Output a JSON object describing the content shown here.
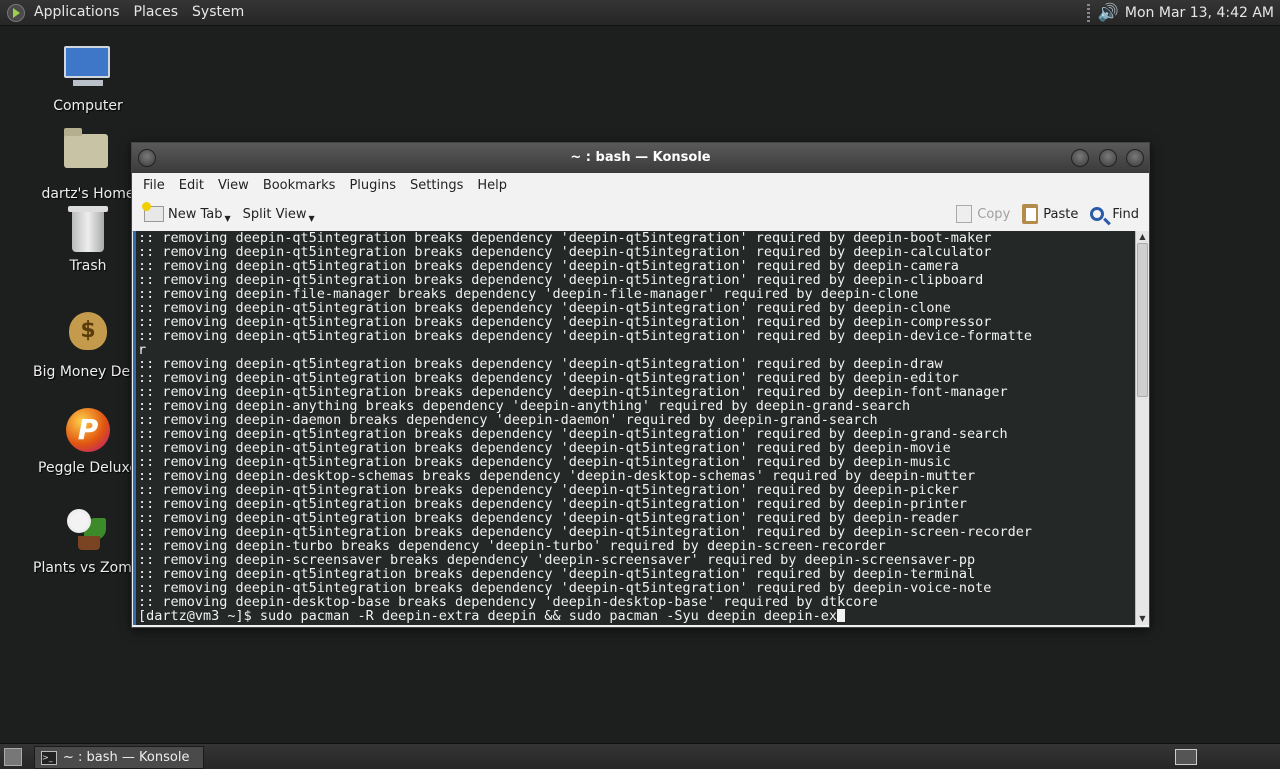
{
  "top_panel": {
    "menus": [
      "Applications",
      "Places",
      "System"
    ],
    "clock": "Mon Mar 13,  4:42 AM",
    "volume_icon": "speaker-icon"
  },
  "desktop_icons": [
    {
      "label": "Computer",
      "icon": "computer-icon"
    },
    {
      "label": "dartz's Home",
      "icon": "home-folder-icon"
    },
    {
      "label": "Trash",
      "icon": "trash-icon"
    },
    {
      "label": "Big Money Delux",
      "icon": "money-bag-icon"
    },
    {
      "label": "Peggle Deluxe",
      "icon": "peggle-icon"
    },
    {
      "label": "Plants vs Zombi",
      "icon": "plants-vs-zombies-icon"
    }
  ],
  "window": {
    "title": "~ : bash — Konsole",
    "menu": [
      "File",
      "Edit",
      "View",
      "Bookmarks",
      "Plugins",
      "Settings",
      "Help"
    ],
    "toolbar": {
      "new_tab": "New Tab",
      "split_view": "Split View",
      "copy": "Copy",
      "paste": "Paste",
      "find": "Find"
    },
    "terminal_text": ":: removing deepin-qt5integration breaks dependency 'deepin-qt5integration' required by deepin-boot-maker\n:: removing deepin-qt5integration breaks dependency 'deepin-qt5integration' required by deepin-calculator\n:: removing deepin-qt5integration breaks dependency 'deepin-qt5integration' required by deepin-camera\n:: removing deepin-qt5integration breaks dependency 'deepin-qt5integration' required by deepin-clipboard\n:: removing deepin-file-manager breaks dependency 'deepin-file-manager' required by deepin-clone\n:: removing deepin-qt5integration breaks dependency 'deepin-qt5integration' required by deepin-clone\n:: removing deepin-qt5integration breaks dependency 'deepin-qt5integration' required by deepin-compressor\n:: removing deepin-qt5integration breaks dependency 'deepin-qt5integration' required by deepin-device-formatte\nr\n:: removing deepin-qt5integration breaks dependency 'deepin-qt5integration' required by deepin-draw\n:: removing deepin-qt5integration breaks dependency 'deepin-qt5integration' required by deepin-editor\n:: removing deepin-qt5integration breaks dependency 'deepin-qt5integration' required by deepin-font-manager\n:: removing deepin-anything breaks dependency 'deepin-anything' required by deepin-grand-search\n:: removing deepin-daemon breaks dependency 'deepin-daemon' required by deepin-grand-search\n:: removing deepin-qt5integration breaks dependency 'deepin-qt5integration' required by deepin-grand-search\n:: removing deepin-qt5integration breaks dependency 'deepin-qt5integration' required by deepin-movie\n:: removing deepin-qt5integration breaks dependency 'deepin-qt5integration' required by deepin-music\n:: removing deepin-desktop-schemas breaks dependency 'deepin-desktop-schemas' required by deepin-mutter\n:: removing deepin-qt5integration breaks dependency 'deepin-qt5integration' required by deepin-picker\n:: removing deepin-qt5integration breaks dependency 'deepin-qt5integration' required by deepin-printer\n:: removing deepin-qt5integration breaks dependency 'deepin-qt5integration' required by deepin-reader\n:: removing deepin-qt5integration breaks dependency 'deepin-qt5integration' required by deepin-screen-recorder\n:: removing deepin-turbo breaks dependency 'deepin-turbo' required by deepin-screen-recorder\n:: removing deepin-screensaver breaks dependency 'deepin-screensaver' required by deepin-screensaver-pp\n:: removing deepin-qt5integration breaks dependency 'deepin-qt5integration' required by deepin-terminal\n:: removing deepin-qt5integration breaks dependency 'deepin-qt5integration' required by deepin-voice-note\n:: removing deepin-desktop-base breaks dependency 'deepin-desktop-base' required by dtkcore",
    "prompt": "[dartz@vm3 ~]$ sudo pacman -R deepin-extra deepin && sudo pacman -Syu deepin deepin-ex"
  },
  "bottom_panel": {
    "task": "~ : bash — Konsole"
  }
}
